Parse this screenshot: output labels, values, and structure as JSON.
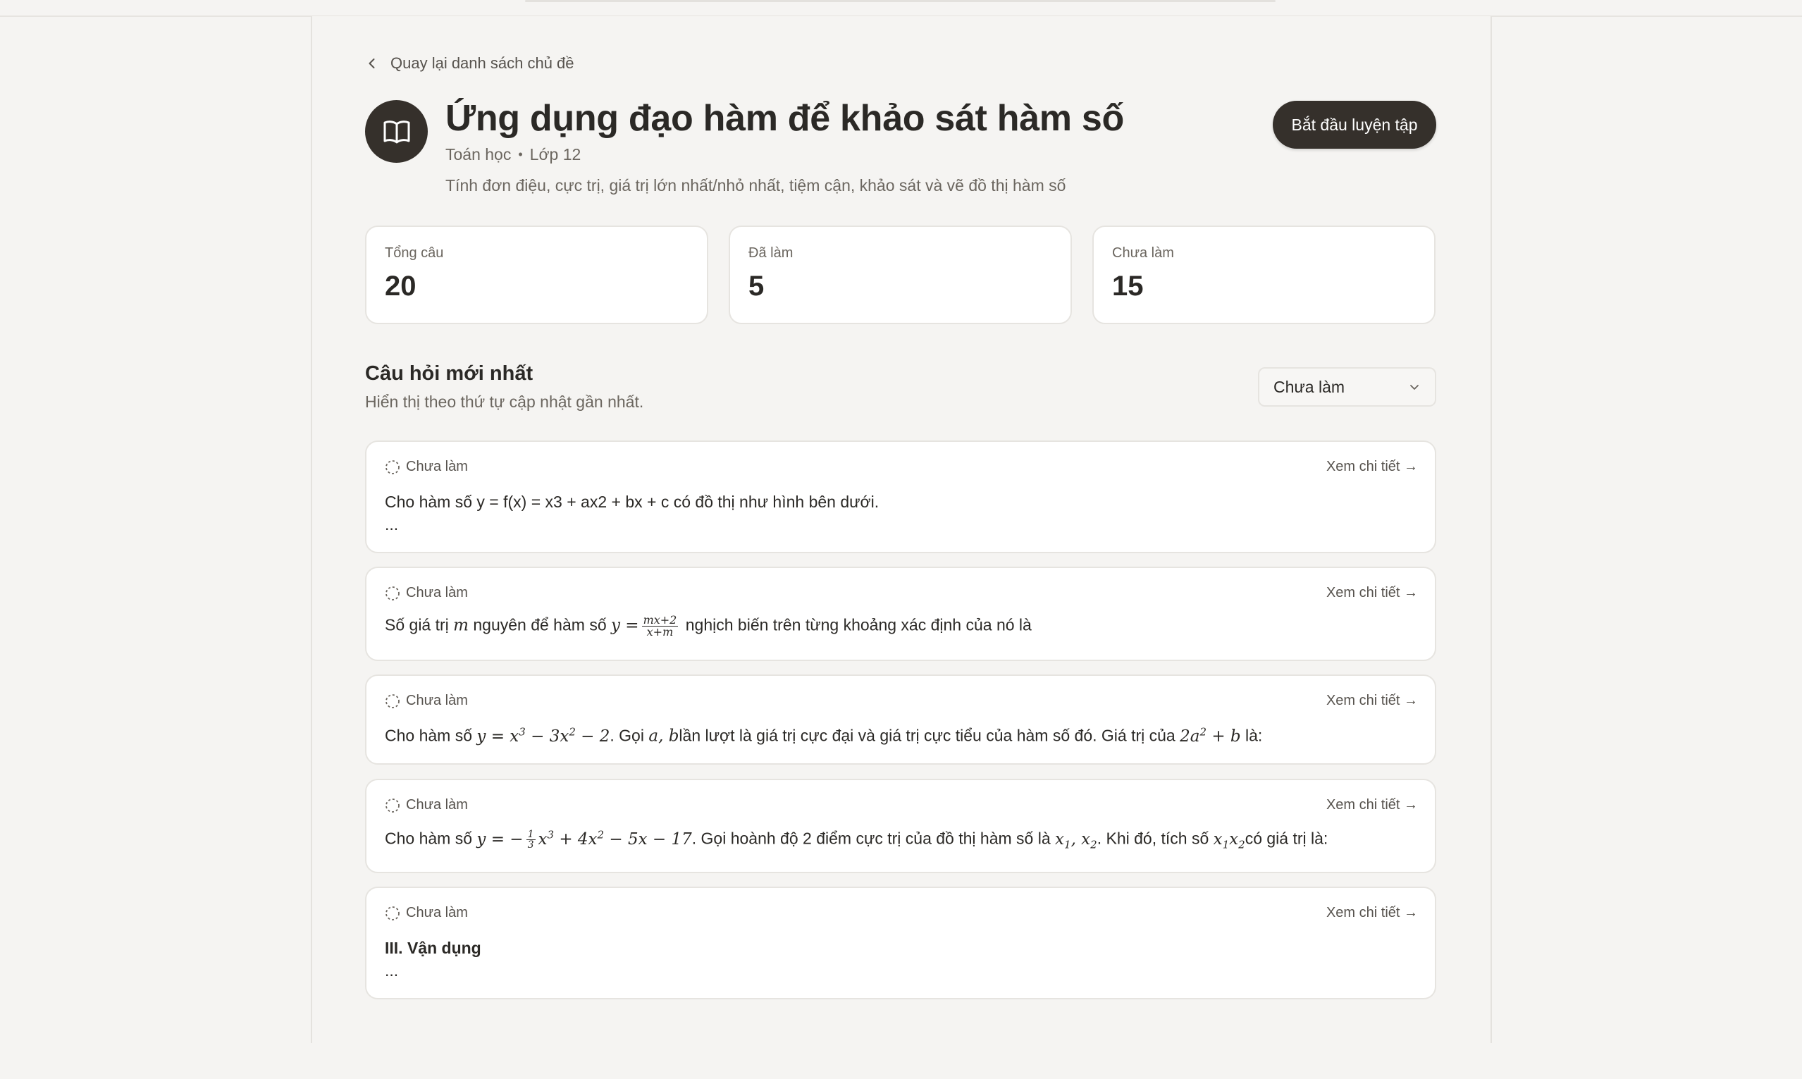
{
  "nav": {
    "back_label": "Quay lại danh sách chủ đề"
  },
  "topic": {
    "title": "Ứng dụng đạo hàm để khảo sát hàm số",
    "subject": "Toán học",
    "grade": "Lớp 12",
    "separator": "•",
    "description": "Tính đơn điệu, cực trị, giá trị lớn nhất/nhỏ nhất, tiệm cận, khảo sát và vẽ đồ thị hàm số",
    "start_button": "Bắt đầu luyện tập",
    "icon": "book-open-icon"
  },
  "stats": [
    {
      "label": "Tổng câu",
      "value": "20"
    },
    {
      "label": "Đã làm",
      "value": "5"
    },
    {
      "label": "Chưa làm",
      "value": "15"
    }
  ],
  "questions_section": {
    "title": "Câu hỏi mới nhất",
    "subtitle": "Hiển thị theo thứ tự cập nhật gần nhất.",
    "filter_value": "Chưa làm"
  },
  "questions": [
    {
      "status": "Chưa làm",
      "detail_link": "Xem chi tiết →",
      "text": "Cho hàm số y = f(x) = x3 + ax2 + bx + c có đồ thị như hình bên dưới.",
      "more": "..."
    },
    {
      "status": "Chưa làm",
      "detail_link": "Xem chi tiết →",
      "pre": "Số giá trị",
      "var_m": "m",
      "mid": "nguyên để hàm số",
      "y_eq": "y =",
      "frac_num": "mx+2",
      "frac_den": "x+m",
      "post": "nghịch biến trên từng khoảng xác định của nó là"
    },
    {
      "status": "Chưa làm",
      "detail_link": "Xem chi tiết →",
      "pre": "Cho hàm số",
      "post": "lần lượt là giá trị cực đại và giá trị cực tiểu của hàm số đó. Giá trị của",
      "end": "là:"
    },
    {
      "status": "Chưa làm",
      "detail_link": "Xem chi tiết →",
      "pre": "Cho hàm số",
      "mid": "Gọi hoành độ 2 điểm cực trị của đồ thị hàm số là",
      "mid2": "Khi đó, tích số",
      "end": "có giá trị là:"
    },
    {
      "status": "Chưa làm",
      "detail_link": "Xem chi tiết →",
      "text": "III. Vận dụng",
      "more": "..."
    }
  ]
}
